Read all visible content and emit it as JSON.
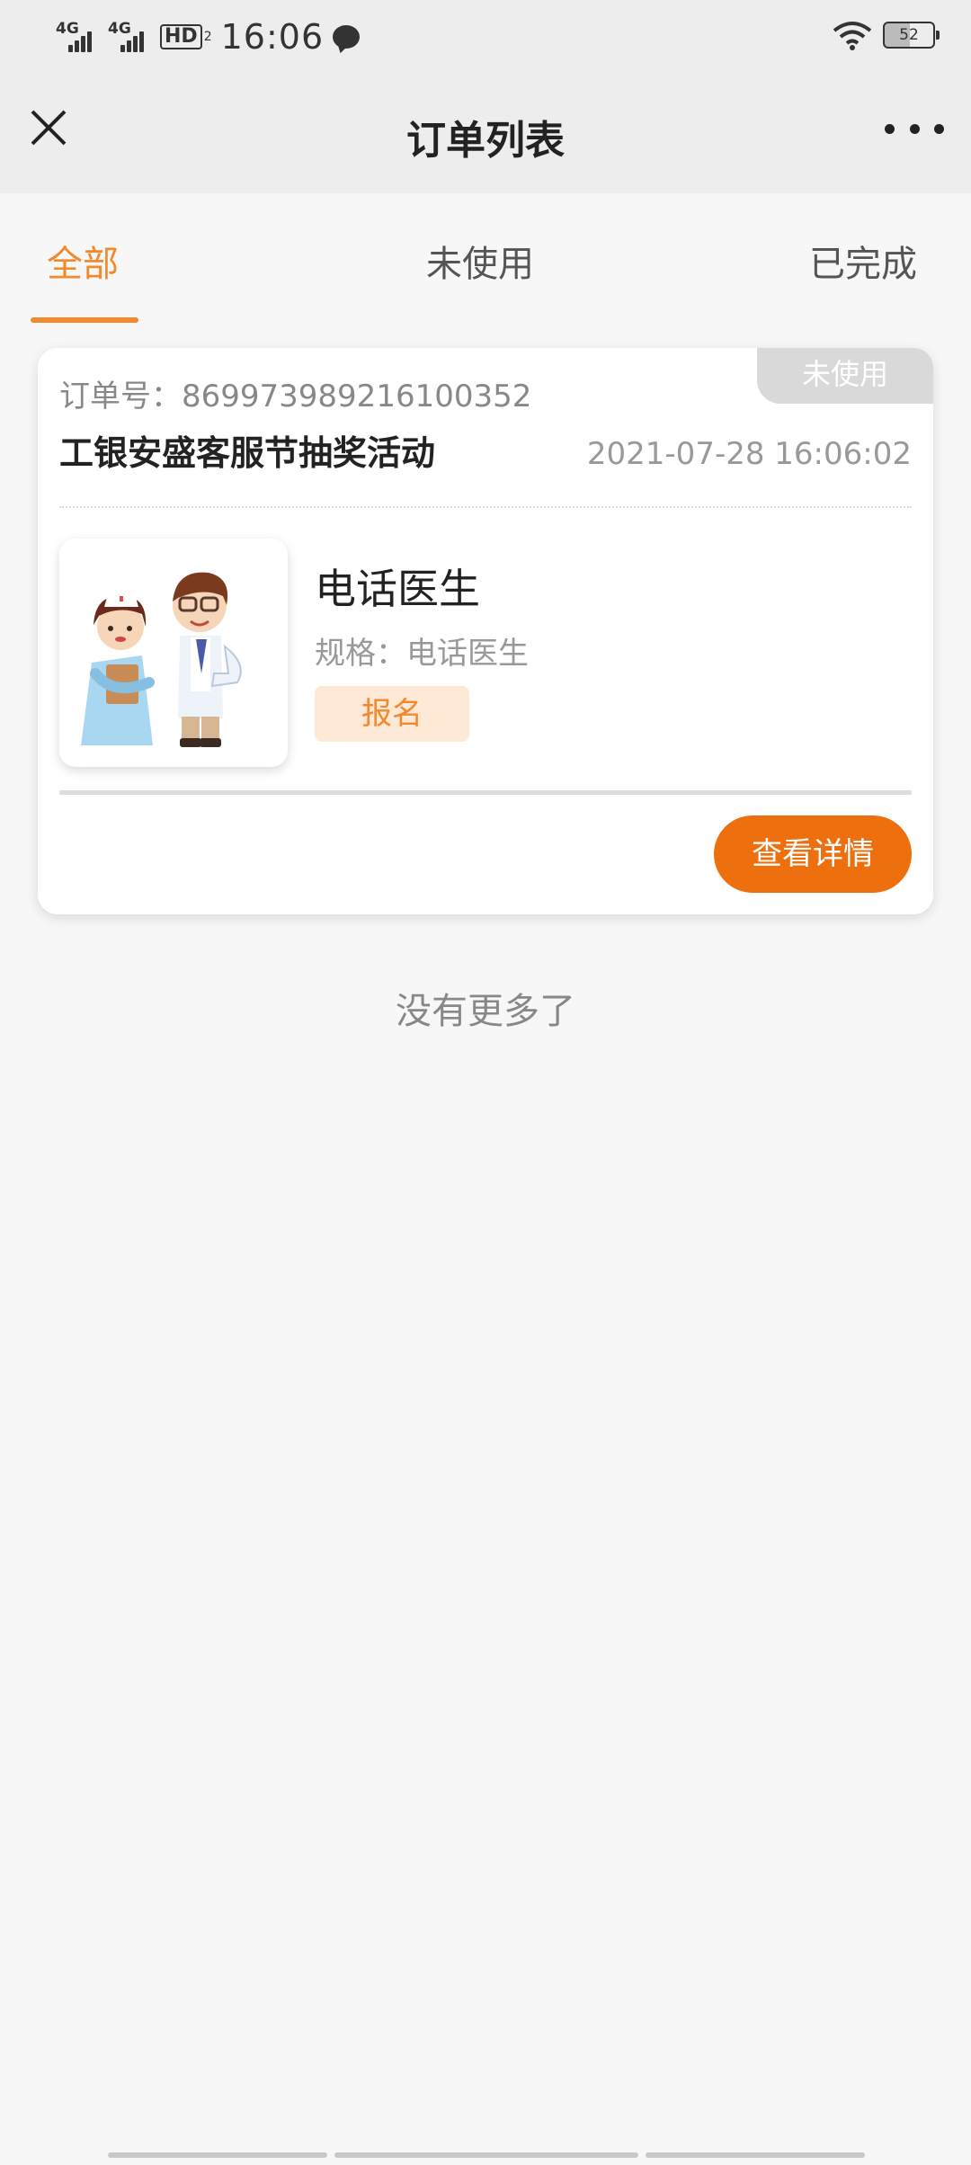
{
  "status_bar": {
    "network1": "4G",
    "network2": "4G",
    "hd": "HD",
    "hd_sub": "2",
    "time": "16:06",
    "battery": "52"
  },
  "nav": {
    "title": "订单列表"
  },
  "tabs": [
    {
      "label": "全部",
      "active": true
    },
    {
      "label": "未使用",
      "active": false
    },
    {
      "label": "已完成",
      "active": false
    }
  ],
  "order": {
    "status": "未使用",
    "order_no_label": "订单号：",
    "order_no": "869973989216100352",
    "activity": "工银安盛客服节抽奖活动",
    "time": "2021-07-28 16:06:02",
    "product_name": "电话医生",
    "spec_label": "规格：",
    "spec_value": "电话医生",
    "tag": "报名",
    "detail_button": "查看详情"
  },
  "no_more_text": "没有更多了",
  "colors": {
    "accent": "#f08a2c",
    "button": "#ee6f0d",
    "badge_bg": "#d9d9d9"
  }
}
